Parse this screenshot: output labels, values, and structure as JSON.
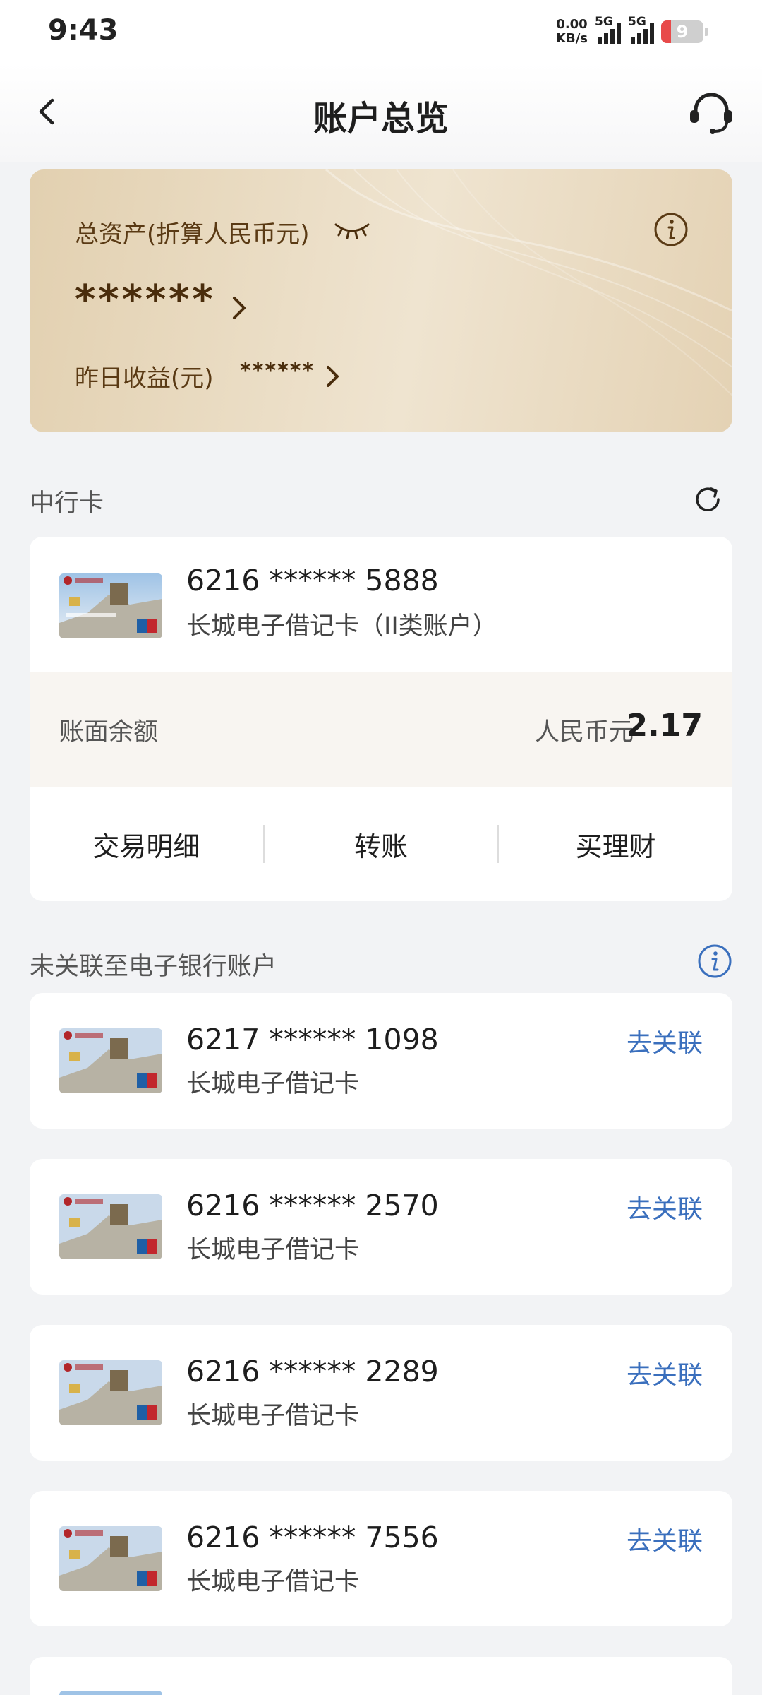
{
  "status_bar": {
    "time": "9:43",
    "net_speed_value": "0.00",
    "net_speed_unit": "KB/s",
    "signal_1_label": "5G",
    "signal_2_label": "5G",
    "battery": "9"
  },
  "header": {
    "title": "账户总览"
  },
  "assets": {
    "total_label": "总资产(折算人民币元)",
    "total_masked": "******",
    "yesterday_label": "昨日收益(元)",
    "yesterday_masked": "******"
  },
  "boc_section": {
    "title": "中行卡",
    "card": {
      "number": "6216 ****** 5888",
      "type": "长城电子借记卡（II类账户）",
      "balance_label": "账面余额",
      "currency": "人民币元",
      "balance": "2.17"
    },
    "actions": [
      "交易明细",
      "转账",
      "买理财"
    ]
  },
  "unlinked_section": {
    "title": "未关联至电子银行账户",
    "link_label": "去关联",
    "cards": [
      {
        "number": "6217 ****** 1098",
        "type": "长城电子借记卡"
      },
      {
        "number": "6216 ****** 2570",
        "type": "长城电子借记卡"
      },
      {
        "number": "6216 ****** 2289",
        "type": "长城电子借记卡"
      },
      {
        "number": "6216 ****** 7556",
        "type": "长城电子借记卡"
      }
    ]
  },
  "colors": {
    "accent_blue": "#3a6fbd",
    "asset_text_brown": "#5a3a14",
    "background": "#f2f3f5"
  }
}
